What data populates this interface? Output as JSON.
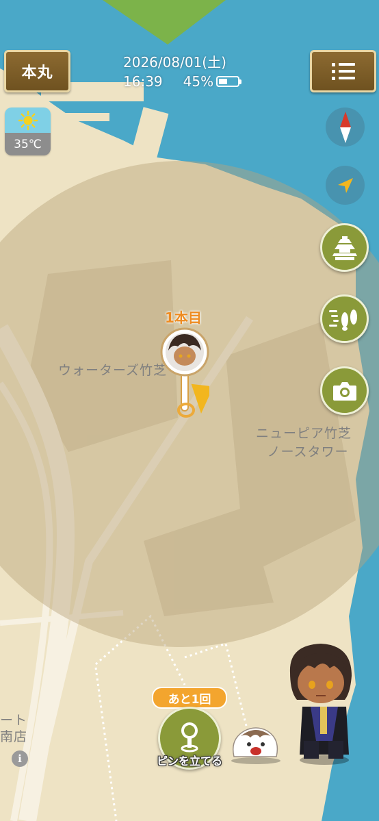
{
  "header": {
    "home_label": "本丸",
    "date": "2026/08/01(土)",
    "time": "16:39",
    "battery_percent_text": "45%",
    "battery_level": 0.45
  },
  "weather": {
    "icon": "sun-icon",
    "temperature": "35℃"
  },
  "map": {
    "labels": {
      "waters": "ウォーターズ竹芝",
      "newpier_line1": "ニューピア竹芝",
      "newpier_line2": "ノースタワー",
      "edge_line1": "ート",
      "edge_line2": "南店"
    },
    "colors": {
      "sea": "#4aa8c8",
      "land": "#eee3c4",
      "range_circle": "#b8a47d",
      "park": "#7cb34a"
    }
  },
  "pin": {
    "count_label": "1本目"
  },
  "actions": {
    "remaining_label": "あと1回",
    "pin_button_label": "ピンを立てる"
  },
  "side_buttons": {
    "compass": "compass-icon",
    "locate": "navigation-arrow-icon",
    "castle": "castle-icon",
    "walk": "footsteps-icon",
    "camera": "camera-icon"
  },
  "accent_colors": {
    "wood": "#7c5d27",
    "green": "#8a9a39",
    "orange": "#f3a52e"
  }
}
